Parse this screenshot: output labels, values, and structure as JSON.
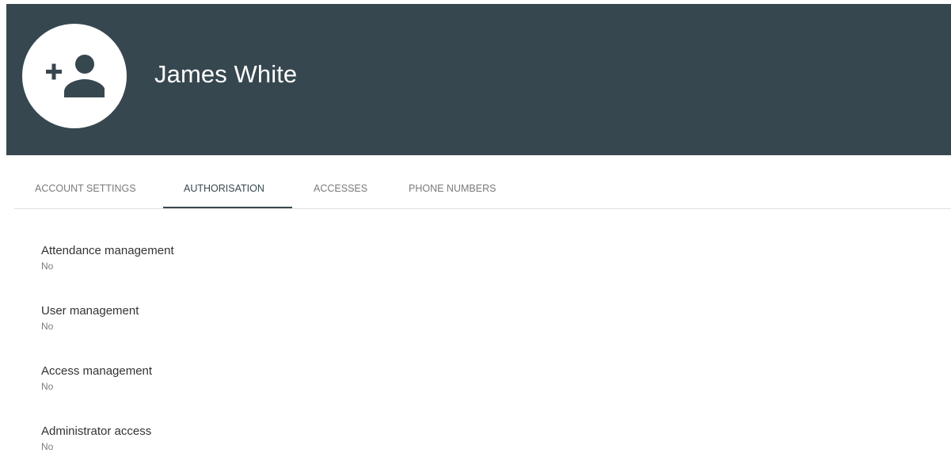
{
  "profile": {
    "name": "James White",
    "avatar_icon": "add-person-icon"
  },
  "tabs": [
    {
      "label": "ACCOUNT SETTINGS",
      "active": false
    },
    {
      "label": "AUTHORISATION",
      "active": true
    },
    {
      "label": "ACCESSES",
      "active": false
    },
    {
      "label": "PHONE NUMBERS",
      "active": false
    }
  ],
  "settings": [
    {
      "label": "Attendance management",
      "value": "No"
    },
    {
      "label": "User management",
      "value": "No"
    },
    {
      "label": "Access management",
      "value": "No"
    },
    {
      "label": "Administrator access",
      "value": "No"
    }
  ],
  "colors": {
    "header_bg": "#37474f",
    "accent": "#37474f"
  }
}
